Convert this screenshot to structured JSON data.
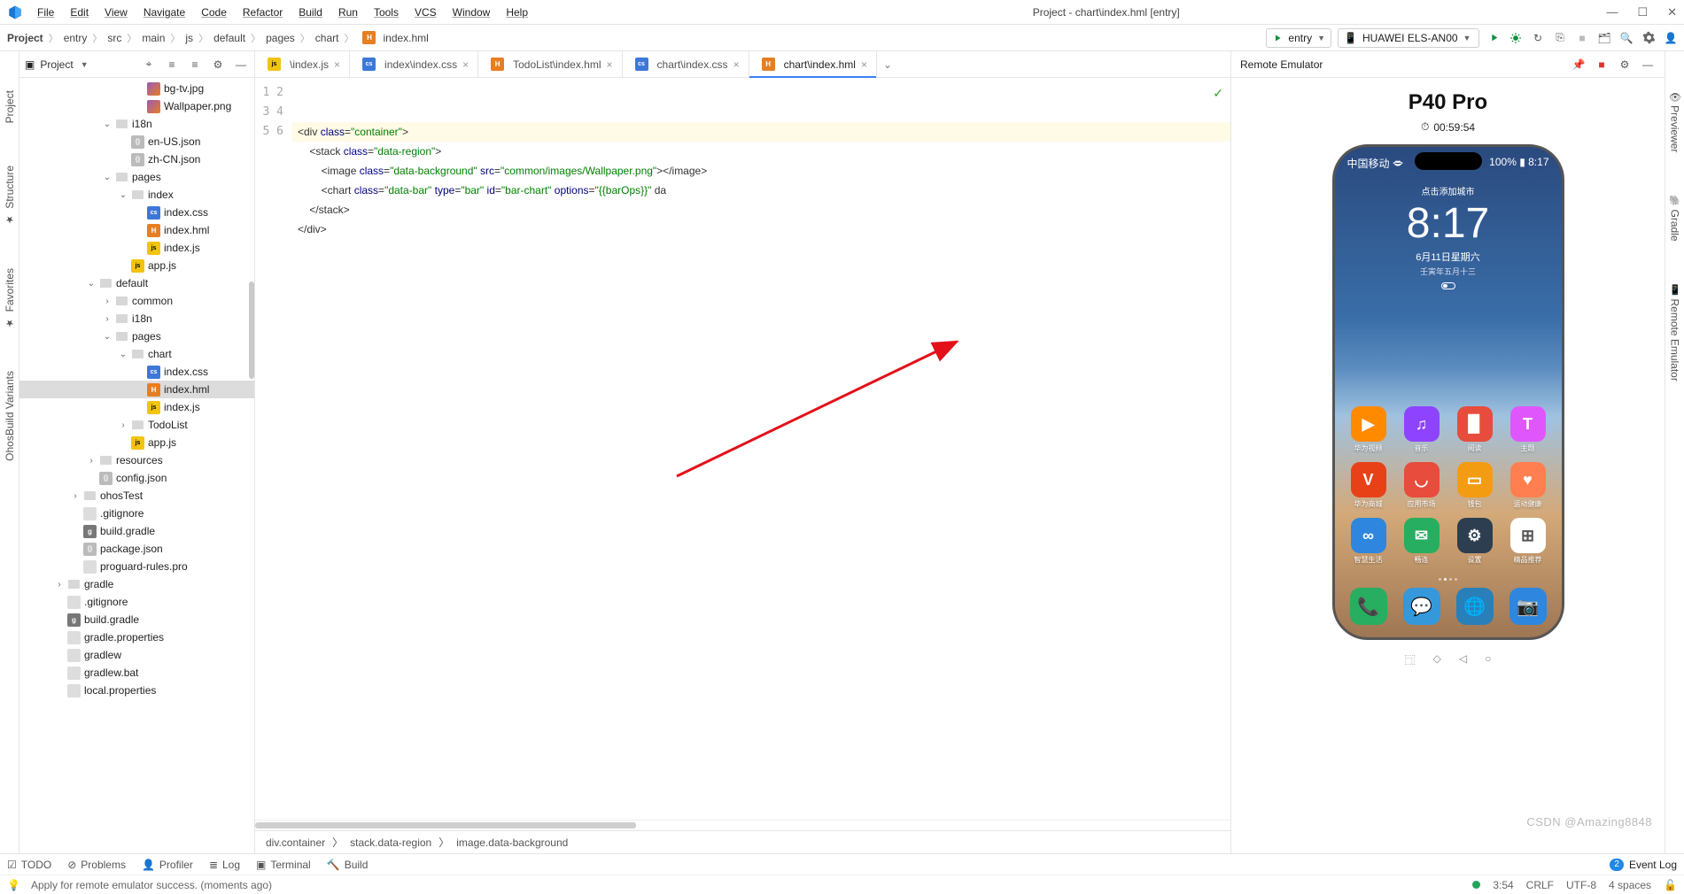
{
  "window_title": "Project - chart\\index.hml [entry]",
  "menus": [
    "File",
    "Edit",
    "View",
    "Navigate",
    "Code",
    "Refactor",
    "Build",
    "Run",
    "Tools",
    "VCS",
    "Window",
    "Help"
  ],
  "breadcrumbs": [
    "Project",
    "entry",
    "src",
    "main",
    "js",
    "default",
    "pages",
    "chart",
    "index.hml"
  ],
  "run_config": {
    "label": "entry"
  },
  "device_combo": {
    "label": "HUAWEI ELS-AN00"
  },
  "sidebar_title": "Project",
  "tree": [
    {
      "d": 5,
      "t": "",
      "i": "img",
      "n": "bg-tv.jpg"
    },
    {
      "d": 5,
      "t": "",
      "i": "img",
      "n": "Wallpaper.png"
    },
    {
      "d": 3,
      "t": "v",
      "i": "folder",
      "n": "i18n"
    },
    {
      "d": 4,
      "t": "",
      "i": "json",
      "n": "en-US.json"
    },
    {
      "d": 4,
      "t": "",
      "i": "json",
      "n": "zh-CN.json"
    },
    {
      "d": 3,
      "t": "v",
      "i": "folder",
      "n": "pages"
    },
    {
      "d": 4,
      "t": "v",
      "i": "folder",
      "n": "index"
    },
    {
      "d": 5,
      "t": "",
      "i": "css",
      "n": "index.css"
    },
    {
      "d": 5,
      "t": "",
      "i": "hml",
      "n": "index.hml"
    },
    {
      "d": 5,
      "t": "",
      "i": "js",
      "n": "index.js"
    },
    {
      "d": 4,
      "t": "",
      "i": "js",
      "n": "app.js"
    },
    {
      "d": 2,
      "t": "v",
      "i": "folder",
      "n": "default"
    },
    {
      "d": 3,
      "t": ">",
      "i": "folder",
      "n": "common"
    },
    {
      "d": 3,
      "t": ">",
      "i": "folder",
      "n": "i18n"
    },
    {
      "d": 3,
      "t": "v",
      "i": "folder",
      "n": "pages"
    },
    {
      "d": 4,
      "t": "v",
      "i": "folder",
      "n": "chart"
    },
    {
      "d": 5,
      "t": "",
      "i": "css",
      "n": "index.css"
    },
    {
      "d": 5,
      "t": "",
      "i": "hml",
      "n": "index.hml",
      "sel": true
    },
    {
      "d": 5,
      "t": "",
      "i": "js",
      "n": "index.js"
    },
    {
      "d": 4,
      "t": ">",
      "i": "folder",
      "n": "TodoList"
    },
    {
      "d": 4,
      "t": "",
      "i": "js",
      "n": "app.js"
    },
    {
      "d": 2,
      "t": ">",
      "i": "folder",
      "n": "resources"
    },
    {
      "d": 2,
      "t": "",
      "i": "json",
      "n": "config.json"
    },
    {
      "d": 1,
      "t": ">",
      "i": "folder",
      "n": "ohosTest"
    },
    {
      "d": 1,
      "t": "",
      "i": "txt",
      "n": ".gitignore"
    },
    {
      "d": 1,
      "t": "",
      "i": "gradle",
      "n": "build.gradle"
    },
    {
      "d": 1,
      "t": "",
      "i": "json",
      "n": "package.json"
    },
    {
      "d": 1,
      "t": "",
      "i": "txt",
      "n": "proguard-rules.pro"
    },
    {
      "d": 0,
      "t": ">",
      "i": "folder",
      "n": "gradle"
    },
    {
      "d": 0,
      "t": "",
      "i": "txt",
      "n": ".gitignore"
    },
    {
      "d": 0,
      "t": "",
      "i": "gradle",
      "n": "build.gradle"
    },
    {
      "d": 0,
      "t": "",
      "i": "txt",
      "n": "gradle.properties"
    },
    {
      "d": 0,
      "t": "",
      "i": "txt",
      "n": "gradlew"
    },
    {
      "d": 0,
      "t": "",
      "i": "txt",
      "n": "gradlew.bat"
    },
    {
      "d": 0,
      "t": "",
      "i": "txt",
      "n": "local.properties"
    }
  ],
  "tabs": [
    {
      "label": "\\index.js",
      "icon": "js"
    },
    {
      "label": "index\\index.css",
      "icon": "css"
    },
    {
      "label": "TodoList\\index.hml",
      "icon": "hml"
    },
    {
      "label": "chart\\index.css",
      "icon": "css"
    },
    {
      "label": "chart\\index.hml",
      "icon": "hml",
      "active": true
    }
  ],
  "code_lines": [
    1,
    2,
    3,
    4,
    5,
    6
  ],
  "code": {
    "l1a": "<div ",
    "l1b": "class",
    "l1c": "=",
    "l1d": "\"container\"",
    "l1e": ">",
    "l2a": "    <stack ",
    "l2b": "class",
    "l2c": "=",
    "l2d": "\"data-region\"",
    "l2e": ">",
    "l3a": "        <image ",
    "l3b": "class",
    "l3c": "=",
    "l3d": "\"data-background\"",
    "l3e": " ",
    "l3f": "src",
    "l3g": "=",
    "l3h": "\"common/images/Wallpaper.png\"",
    "l3i": "></image>",
    "l4a": "        <chart ",
    "l4b": "class",
    "l4c": "=",
    "l4d": "\"data-bar\"",
    "l4e": " ",
    "l4f": "type",
    "l4g": "=",
    "l4h": "\"bar\"",
    "l4i": " ",
    "l4j": "id",
    "l4k": "=",
    "l4l": "\"bar-chart\"",
    "l4m": " ",
    "l4n": "options",
    "l4o": "=",
    "l4p": "\"{{barOps}}\"",
    "l4q": " da",
    "l5a": "    </stack>",
    "l6a": "</div>"
  },
  "structure_crumbs": [
    "div.container",
    "stack.data-region",
    "image.data-background"
  ],
  "remote_emulator_title": "Remote Emulator",
  "emulator": {
    "device": "P40 Pro",
    "timer": "00:59:54",
    "status_left": "中国移动 🗢",
    "status_right": "100% ▮ 8:17",
    "header_tip": "点击添加城市",
    "time": "8:17",
    "date": "6月11日星期六",
    "lunar": "壬寅年五月十三",
    "apps": [
      {
        "bg": "#ff8a00",
        "g": "▶",
        "lbl": "华为视频"
      },
      {
        "bg": "#8e44ff",
        "g": "♫",
        "lbl": "音乐"
      },
      {
        "bg": "#e74c3c",
        "g": "▉",
        "lbl": "阅读"
      },
      {
        "bg": "#e056fd",
        "g": "T",
        "lbl": "主题"
      },
      {
        "bg": "#e84118",
        "g": "V",
        "lbl": "华为商城"
      },
      {
        "bg": "#e74c3c",
        "g": "◡",
        "lbl": "应用市场"
      },
      {
        "bg": "#f39c12",
        "g": "▭",
        "lbl": "钱包"
      },
      {
        "bg": "#ff7f50",
        "g": "♥",
        "lbl": "运动健康"
      },
      {
        "bg": "#2e86de",
        "g": "∞",
        "lbl": "智慧生活"
      },
      {
        "bg": "#27ae60",
        "g": "✉",
        "lbl": "畅连"
      },
      {
        "bg": "#2c3e50",
        "g": "⚙",
        "lbl": "设置"
      },
      {
        "bg": "#ffffff",
        "g": "⊞",
        "lbl": "精品推荐"
      }
    ],
    "dock": [
      {
        "bg": "#27ae60",
        "g": "📞"
      },
      {
        "bg": "#3498db",
        "g": "💬"
      },
      {
        "bg": "#2980b9",
        "g": "🌐"
      },
      {
        "bg": "#2e86de",
        "g": "📷"
      }
    ]
  },
  "left_tabs": [
    "Project",
    "Structure",
    "Favorites",
    "OhosBuild Variants"
  ],
  "right_tabs": [
    "Previewer",
    "Gradle",
    "Remote Emulator"
  ],
  "bottom_tabs": [
    "TODO",
    "Problems",
    "Profiler",
    "Log",
    "Terminal",
    "Build"
  ],
  "event_log": {
    "count": "2",
    "label": "Event Log"
  },
  "status_msg": "Apply for remote emulator success. (moments ago)",
  "status_right": {
    "time": "3:54",
    "enc": "CRLF",
    "charset": "UTF-8",
    "indent": "4 spaces"
  },
  "watermark": "CSDN @Amazing8848"
}
